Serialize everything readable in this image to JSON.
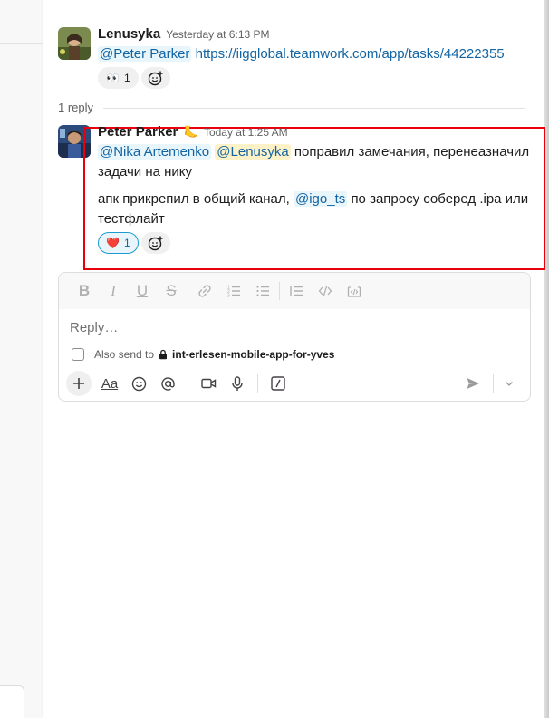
{
  "thread": {
    "parent": {
      "sender": "Lenusyka",
      "timestamp": "Yesterday at 6:13 PM",
      "mention": "@Peter Parker",
      "link": "https://iigglobal.teamwork.com/app/tasks/44222355",
      "reaction": {
        "emoji": "👀",
        "count": "1"
      }
    },
    "reply_count_label": "1 reply",
    "reply": {
      "sender": "Peter Parker",
      "status_emoji": "🦶",
      "timestamp": "Today at 1:25 AM",
      "line1": {
        "mention_a": "@Nika Artemenko",
        "mention_b": "@Lenusyka",
        "text": "поправил замечания, перенеазначил"
      },
      "line2": "задачи на нику",
      "line3": {
        "text_before": "апк прикрепил в общий канал,",
        "mention": "@igo_ts",
        "text_after": "по запросу соберед .ipa или"
      },
      "line4": "тестфлайт",
      "reaction": {
        "emoji": "❤️",
        "count": "1"
      }
    }
  },
  "composer": {
    "placeholder": "Reply…",
    "also_send_label": "Also send to",
    "channel": "int-erlesen-mobile-app-for-yves",
    "format_icons": [
      "bold-icon",
      "italic-icon",
      "underline-icon",
      "strikethrough-icon",
      "link-icon",
      "ordered-list-icon",
      "bulleted-list-icon",
      "blockquote-icon",
      "code-icon",
      "code-block-icon"
    ],
    "bottom_icons": [
      "plus-icon",
      "text-format-icon",
      "emoji-icon",
      "mention-icon",
      "video-icon",
      "microphone-icon",
      "slash-command-icon"
    ],
    "format_label": "Aa"
  },
  "colors": {
    "link": "#1264a3",
    "highlight_border": "#e8000d",
    "reaction_active": "#1d9bd1",
    "heart": "#e01e5a"
  }
}
